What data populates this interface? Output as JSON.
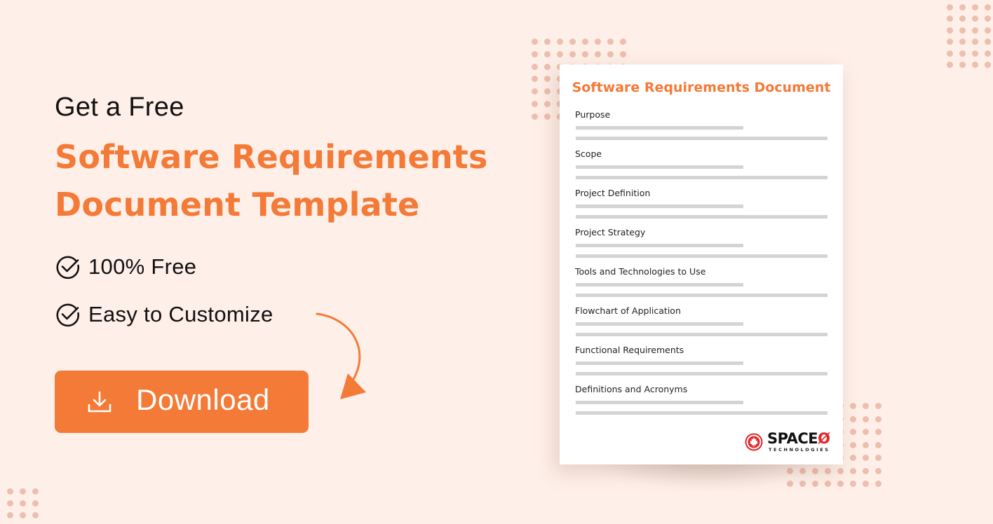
{
  "colors": {
    "background": "#FEEFE8",
    "accent": "#F47A37",
    "dots": "#EDBFAE",
    "placeholder_bar": "#D4D4D4",
    "logo_red": "#E2262A"
  },
  "hero": {
    "pre_title": "Get a Free",
    "title_line1": "Software Requirements",
    "title_line2": "Document Template"
  },
  "features": [
    {
      "icon": "check-circle-icon",
      "label": "100% Free"
    },
    {
      "icon": "check-circle-icon",
      "label": "Easy to Customize"
    }
  ],
  "cta": {
    "icon": "download-icon",
    "label": "Download"
  },
  "document": {
    "title": "Software Requirements Document",
    "sections": [
      {
        "label": "Purpose"
      },
      {
        "label": "Scope"
      },
      {
        "label": "Project Definition"
      },
      {
        "label": "Project Strategy"
      },
      {
        "label": "Tools and Technologies to Use"
      },
      {
        "label": "Flowchart of Application"
      },
      {
        "label": "Functional Requirements"
      },
      {
        "label": "Definitions and Acronyms"
      }
    ],
    "logo": {
      "word": "SPACE",
      "word_suffix": "Ø",
      "sub": "TECHNOLOGIES",
      "icon": "maple-leaf-icon"
    }
  }
}
